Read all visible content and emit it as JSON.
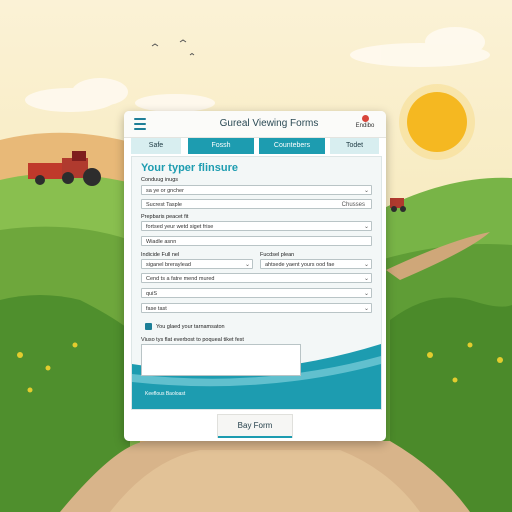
{
  "window": {
    "title": "Gureal Viewing Forms",
    "user_label": "Endibo"
  },
  "tabs": [
    {
      "label": "Safe"
    },
    {
      "label": "Fossh"
    },
    {
      "label": "Countebers"
    },
    {
      "label": "Todet"
    }
  ],
  "form": {
    "heading": "Your typer flinsure",
    "section_label": "Conduug inugs",
    "select_1_value": "sa ye or gncher",
    "row_1_left": "Sucrest Tasple",
    "row_1_right": "Chusses",
    "label_2": "Prepbaris peacet fit",
    "select_2_value": "fortsed yeur wetd siget frise",
    "field_3_value": "Wiadle asnn",
    "label_left_4": "Indicide Full nel",
    "label_right_4": "Fucdsel plean",
    "select_left_4": "siganel breraylead",
    "select_right_4": "ahtsede yaent yours ood fae",
    "select_5_value": "Cend ts a fatre mend mured",
    "select_6_value": "quiS",
    "select_7_value": "fase tast",
    "checkbox_label": "You glaed your tarnamsaton",
    "textarea_label": "Viuso tys flat everbost to poqueal tiket fest",
    "footer_note": "Keeflous Baoloast",
    "submit_label": "Bay Form"
  },
  "colors": {
    "accent": "#1d9cb0",
    "sky": "#f6ecc4",
    "grass": "#6dab3e",
    "sun": "#f5b316",
    "path": "#d8b48a"
  }
}
